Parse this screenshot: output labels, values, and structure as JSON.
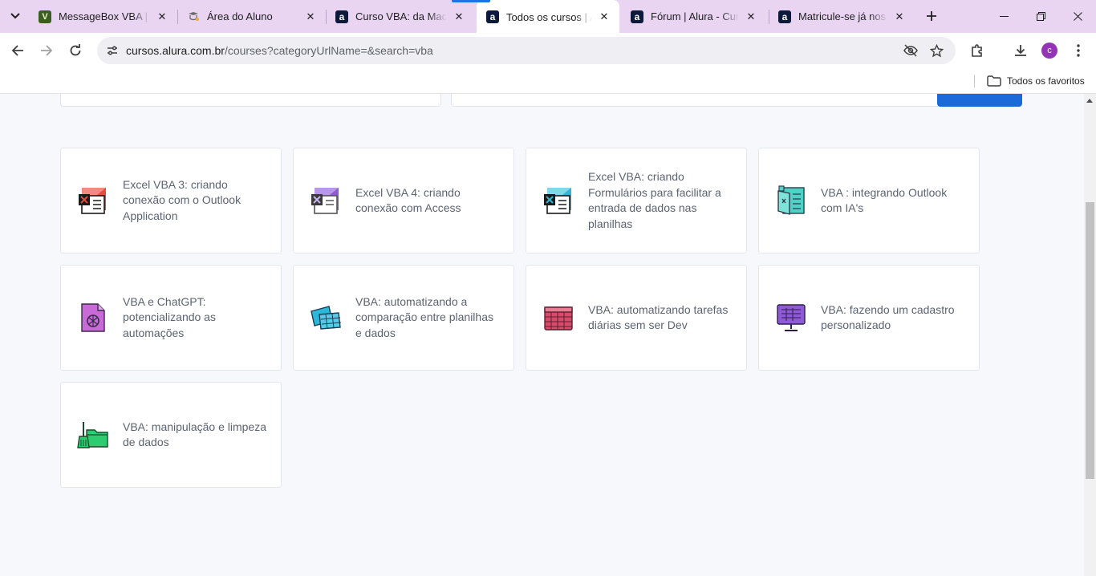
{
  "browser": {
    "tabs": [
      {
        "title": "MessageBox VBA | Su",
        "favicon": "messagebox-favicon",
        "active": false
      },
      {
        "title": "Área do Aluno",
        "favicon": "alura-student-favicon",
        "active": false
      },
      {
        "title": "Curso VBA: da Macro",
        "favicon": "alura-favicon",
        "active": false
      },
      {
        "title": "Todos os cursos | Alu",
        "favicon": "alura-favicon",
        "active": true
      },
      {
        "title": "Fórum | Alura - Curso",
        "favicon": "alura-favicon",
        "active": false
      },
      {
        "title": "Matricule-se já nos cu",
        "favicon": "alura-favicon",
        "active": false
      }
    ],
    "address": {
      "host": "cursos.alura.com.br",
      "path": "/courses?categoryUrlName=&search=vba"
    },
    "profile_initial": "c",
    "bookmarks": {
      "all_bookmarks_label": "Todos os favoritos"
    },
    "colors": {
      "tabstrip": "#e9d4f2",
      "accent": "#1a73e8",
      "profile": "#9334b6"
    }
  },
  "courses": [
    {
      "title": "Excel VBA 3: criando conexão com o Outlook Application",
      "icon": "excel-outlook-icon",
      "icon_color": "#e74c3c"
    },
    {
      "title": "Excel VBA 4: criando conexão com Access",
      "icon": "excel-access-icon",
      "icon_color": "#8e5ad6"
    },
    {
      "title": "Excel VBA: criando Formulários para facilitar a entrada de dados nas planilhas",
      "icon": "excel-forms-icon",
      "icon_color": "#2bb8d9"
    },
    {
      "title": "VBA : integrando Outlook com IA's",
      "icon": "outlook-ai-icon",
      "icon_color": "#4fd1c5"
    },
    {
      "title": "VBA e ChatGPT: potencializando as automações",
      "icon": "chatgpt-document-icon",
      "icon_color": "#c86bd6"
    },
    {
      "title": "VBA: automatizando a comparação entre planilhas e dados",
      "icon": "spreadsheets-compare-icon",
      "icon_color": "#2bb8d9"
    },
    {
      "title": "VBA: automatizando tarefas diárias sem ser Dev",
      "icon": "calendar-grid-icon",
      "icon_color": "#d94b6b"
    },
    {
      "title": "VBA: fazendo um cadastro personalizado",
      "icon": "monitor-form-icon",
      "icon_color": "#8e5ad6"
    },
    {
      "title": "VBA: manipulação e limpeza de dados",
      "icon": "broom-folder-icon",
      "icon_color": "#2ecc71"
    }
  ]
}
